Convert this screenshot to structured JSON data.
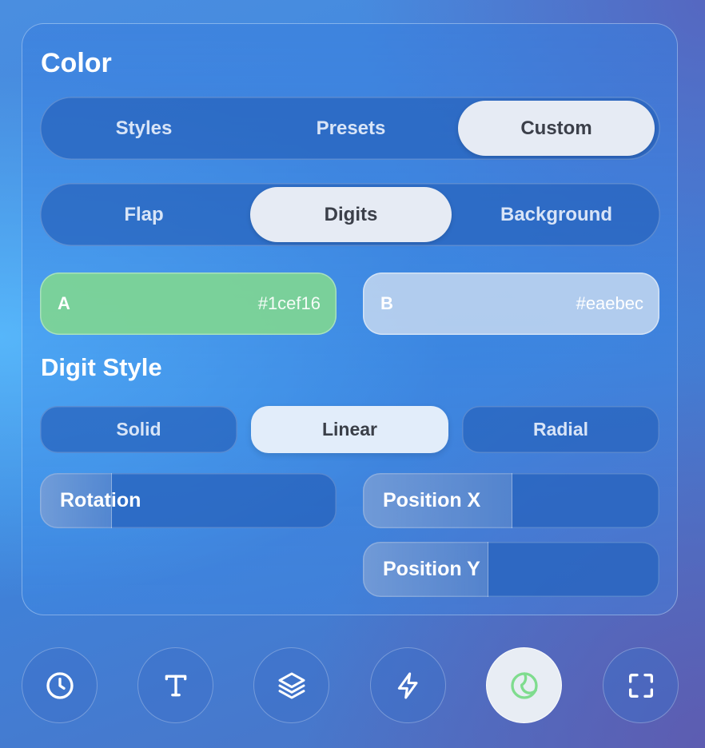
{
  "panel": {
    "title": "Color",
    "mode_tabs": [
      {
        "label": "Styles",
        "active": false
      },
      {
        "label": "Presets",
        "active": false
      },
      {
        "label": "Custom",
        "active": true
      }
    ],
    "target_tabs": [
      {
        "label": "Flap",
        "active": false
      },
      {
        "label": "Digits",
        "active": true
      },
      {
        "label": "Background",
        "active": false
      }
    ],
    "swatches": [
      {
        "label": "A",
        "hex": "#1cef16",
        "display_color": "#7dd496"
      },
      {
        "label": "B",
        "hex": "#eaebec",
        "display_color": "#bed4f0"
      }
    ],
    "digit_style_heading": "Digit Style",
    "digit_styles": [
      {
        "label": "Solid",
        "active": false
      },
      {
        "label": "Linear",
        "active": true
      },
      {
        "label": "Radial",
        "active": false
      }
    ],
    "sliders": {
      "rotation": {
        "label": "Rotation",
        "value_fraction": 0.24
      },
      "position_x": {
        "label": "Position X",
        "value_fraction": 0.5
      },
      "position_y": {
        "label": "Position Y",
        "value_fraction": 0.42
      }
    }
  },
  "dock": {
    "buttons": [
      {
        "icon": "clock-icon",
        "active": false
      },
      {
        "icon": "text-icon",
        "active": false
      },
      {
        "icon": "layers-icon",
        "active": false
      },
      {
        "icon": "bolt-icon",
        "active": false
      },
      {
        "icon": "color-palette-icon",
        "active": true,
        "accent": "#7fdc8e"
      },
      {
        "icon": "fullscreen-icon",
        "active": false
      }
    ]
  }
}
